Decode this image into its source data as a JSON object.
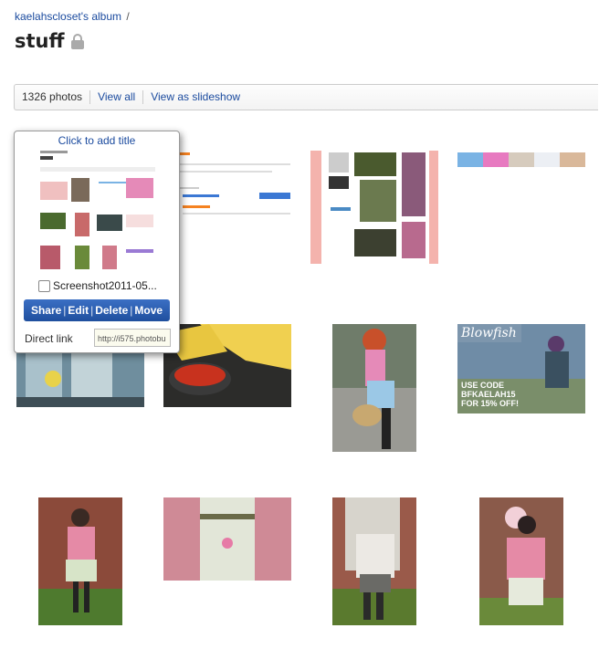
{
  "breadcrumb": {
    "album_link": "kaelahscloset's album",
    "separator": "/"
  },
  "page": {
    "title": "stuff",
    "privacy_icon": "lock-icon"
  },
  "toolbar": {
    "count": "1326 photos",
    "view_all": "View all",
    "slideshow": "View as slideshow"
  },
  "popup": {
    "title_prompt": "Click to add title",
    "filename": "Screenshot2011-05...",
    "actions": [
      "Share",
      "Edit",
      "Delete",
      "Move"
    ],
    "direct_link_label": "Direct link",
    "direct_link_value": "http://i575.photobu"
  },
  "colors": {
    "link": "#1a4a9e",
    "button": "#2a5cb0"
  }
}
